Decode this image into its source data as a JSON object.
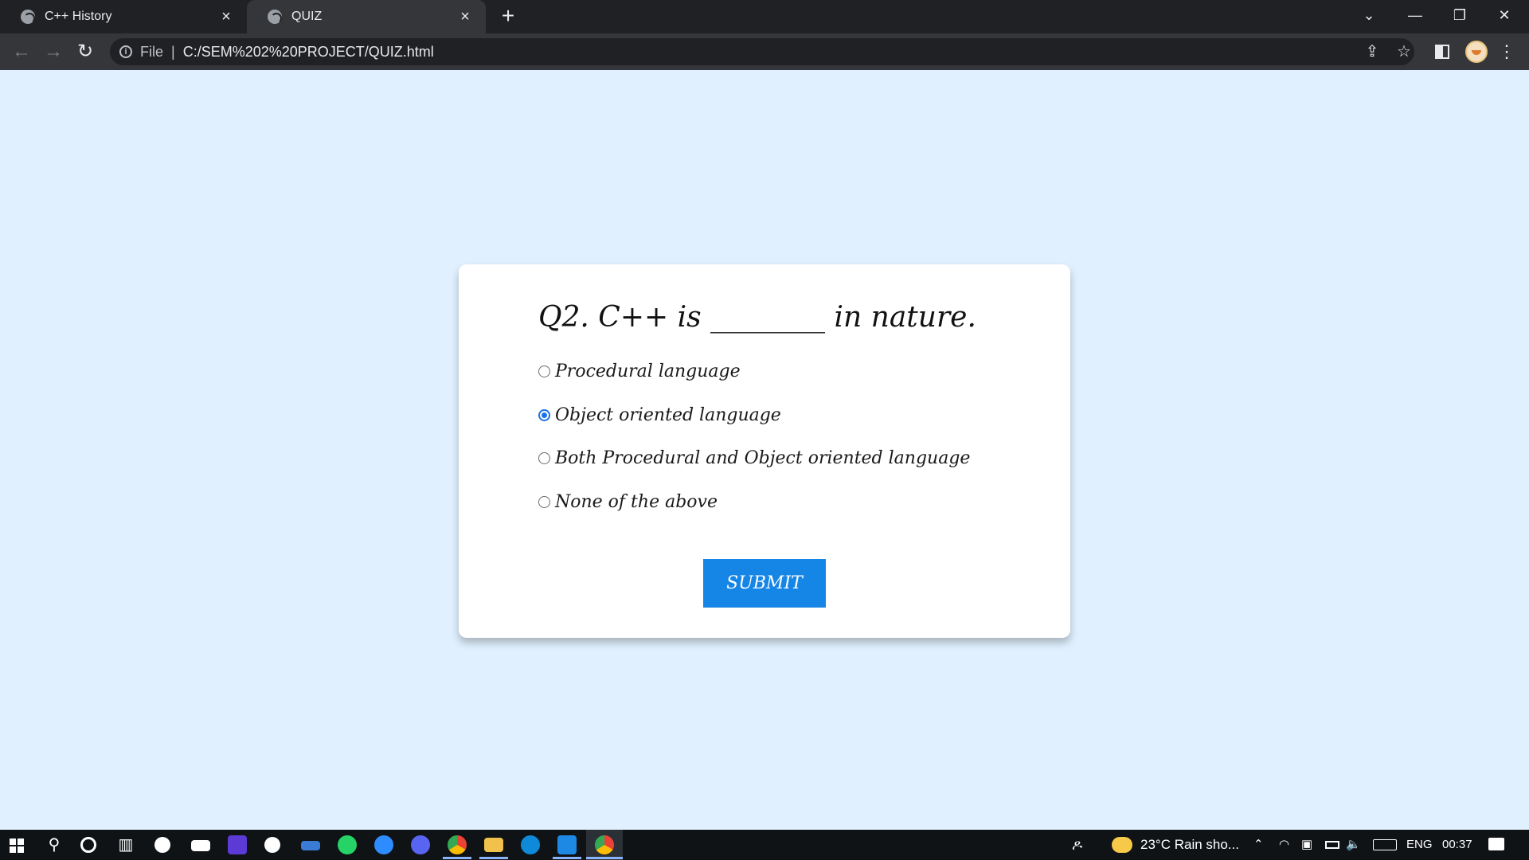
{
  "browser": {
    "tabs": [
      {
        "title": "C++ History",
        "active": false
      },
      {
        "title": "QUIZ",
        "active": true
      }
    ],
    "address": {
      "scheme_label": "File",
      "url": "C:/SEM%202%20PROJECT/QUIZ.html"
    }
  },
  "quiz": {
    "question": "Q2. C++ is ________ in nature.",
    "options": [
      {
        "label": "Procedural language",
        "selected": false
      },
      {
        "label": "Object oriented language",
        "selected": true
      },
      {
        "label": "Both Procedural and Object oriented language",
        "selected": false
      },
      {
        "label": "None of the above",
        "selected": false
      }
    ],
    "submit_label": "SUBMIT"
  },
  "taskbar": {
    "weather": "23°C  Rain sho...",
    "language": "ENG",
    "time": "00:37"
  },
  "colors": {
    "page_background": "#e0f0fe",
    "submit_button": "#1585e6",
    "radio_checked": "#1a73e8"
  }
}
